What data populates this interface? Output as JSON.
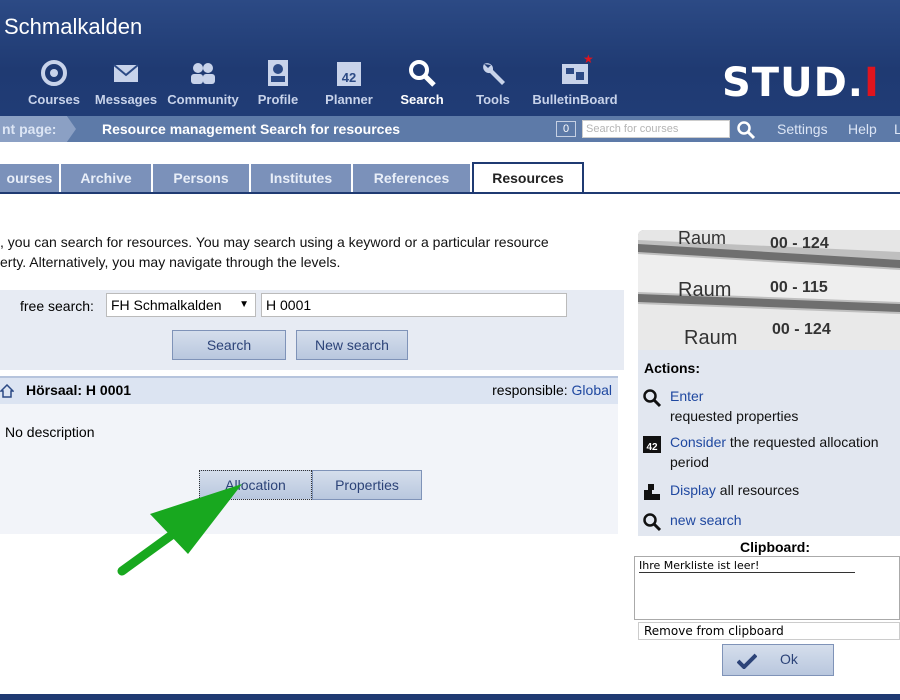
{
  "header": {
    "site_title": "Schmalkalden",
    "logo": "STUD.",
    "logo_dot": "I",
    "nav": [
      {
        "label": "Courses",
        "icon": "courses-icon"
      },
      {
        "label": "Messages",
        "icon": "envelope-icon"
      },
      {
        "label": "Community",
        "icon": "people-icon"
      },
      {
        "label": "Profile",
        "icon": "profile-icon"
      },
      {
        "label": "Planner",
        "icon": "calendar-icon"
      },
      {
        "label": "Search",
        "icon": "search-icon",
        "active": true
      },
      {
        "label": "Tools",
        "icon": "wrench-icon"
      },
      {
        "label": "BulletinBoard",
        "icon": "board-icon"
      }
    ]
  },
  "location": {
    "label": "nt page:",
    "text": "Resource management Search for resources",
    "course_count": "0",
    "search_placeholder": "Search for courses",
    "settings": "Settings",
    "help": "Help",
    "logout": "L"
  },
  "tabs": [
    "ourses",
    "Archive",
    "Persons",
    "Institutes",
    "References",
    "Resources"
  ],
  "active_tab": "Resources",
  "intro": {
    "line1": ", you can search for resources. You may search using a keyword or a particular resource",
    "line2": "erty. Alternatively, you may navigate through the levels."
  },
  "search": {
    "free_label": "free search:",
    "scope_value": "FH Schmalkalden",
    "keyword_value": "H 0001",
    "search_button": "Search",
    "new_search_button": "New search"
  },
  "result": {
    "title": "Hörsaal: H 0001",
    "responsible_label": "responsible:",
    "responsible_value": "Global",
    "description": "No description",
    "allocation_button": "Allocation",
    "properties_button": "Properties"
  },
  "sidebar": {
    "photo_labels": [
      {
        "word": "Raum",
        "num": "00 - 124"
      },
      {
        "word": "Raum",
        "num": "00 - 115"
      },
      {
        "word": "Raum",
        "num": "00 - 124"
      }
    ],
    "actions_title": "Actions:",
    "actions": [
      {
        "link": "Enter",
        "rest": "requested properties"
      },
      {
        "link": "Consider",
        "rest": "the requested allocation period"
      },
      {
        "link": "Display",
        "rest": "all resources"
      },
      {
        "link": "new search",
        "rest": ""
      }
    ]
  },
  "clipboard": {
    "title": "Clipboard:",
    "empty_text": "Ihre Merkliste ist leer!",
    "remove_option": "Remove from clipboard",
    "ok_button": "Ok"
  }
}
